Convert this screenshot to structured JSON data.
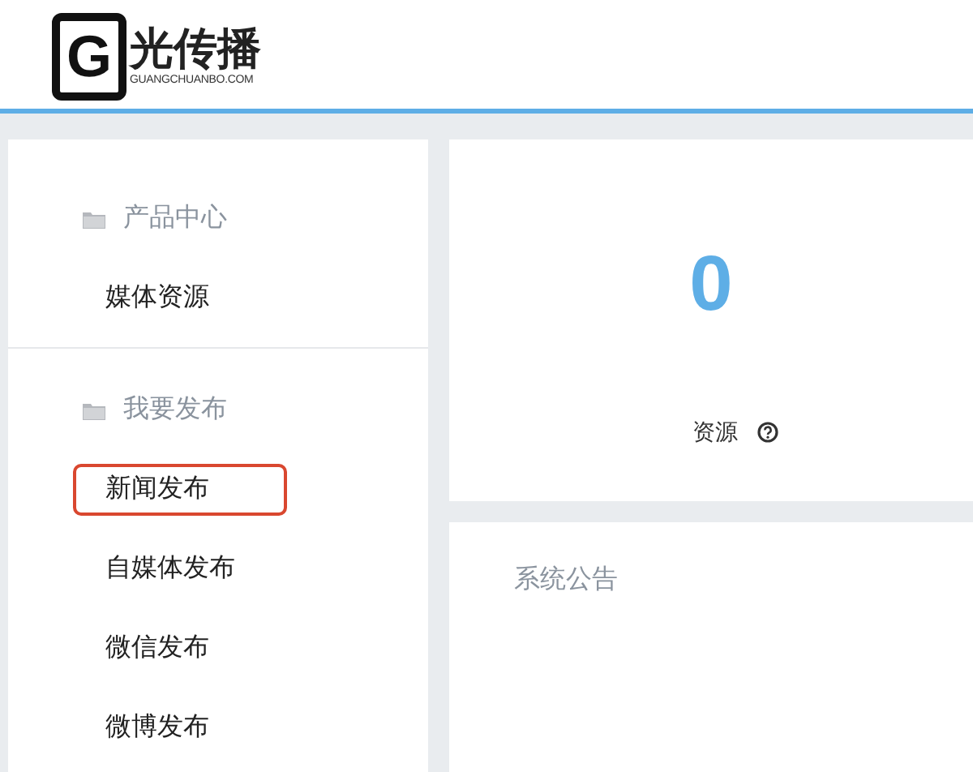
{
  "logo": {
    "letter": "G",
    "name": "光传播",
    "domain": "GUANGCHUANBO.COM"
  },
  "sidebar": {
    "sections": [
      {
        "title": "产品中心",
        "items": [
          {
            "label": "媒体资源",
            "highlighted": false
          }
        ]
      },
      {
        "title": "我要发布",
        "items": [
          {
            "label": "新闻发布",
            "highlighted": true
          },
          {
            "label": "自媒体发布",
            "highlighted": false
          },
          {
            "label": "微信发布",
            "highlighted": false
          },
          {
            "label": "微博发布",
            "highlighted": false
          }
        ]
      }
    ]
  },
  "stat_card": {
    "value": "0",
    "label": "资源"
  },
  "notice_card": {
    "title": "系统公告"
  }
}
